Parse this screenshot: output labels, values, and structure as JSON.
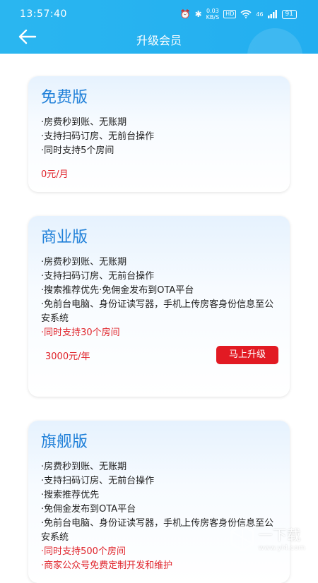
{
  "status_bar": {
    "time": "13:57:40",
    "net_speed": "0.03",
    "net_unit": "KB/S",
    "hd": "HD",
    "signal": "46",
    "battery": "91"
  },
  "header": {
    "title": "升级会员"
  },
  "plans": [
    {
      "name": "免费版",
      "features": [
        "·房费秒到账、无账期",
        "·支持扫码订房、无前台操作",
        "·同时支持5个房间"
      ],
      "price": "0元/月"
    },
    {
      "name": "商业版",
      "features": [
        "·房费秒到账、无账期",
        "·支持扫码订房、无前台操作",
        "·搜索推荐优先·免佣金发布到OTA平台",
        "·免前台电脑、身份证读写器，手机上传房客身份信息至公安系统"
      ],
      "highlight": "·同时支持30个房间",
      "price": "3000元/年",
      "upgrade_label": "马上升级"
    },
    {
      "name": "旗舰版",
      "features": [
        "·房费秒到账、无账期",
        "·支持扫码订房、无前台操作",
        "·搜索推荐优先",
        "·免佣金发布到OTA平台",
        "·免前台电脑、身份证读写器，手机上传房客身份信息至公安系统"
      ],
      "highlights": [
        "·同时支持500个房间",
        "·商家公众号免费定制开发和维护"
      ]
    }
  ],
  "watermark": {
    "text": "一下载",
    "url": "www.yi4.com"
  },
  "colors": {
    "header_blue": "#23aef0",
    "title_blue": "#1e7fd8",
    "accent_red": "#e21a23"
  }
}
